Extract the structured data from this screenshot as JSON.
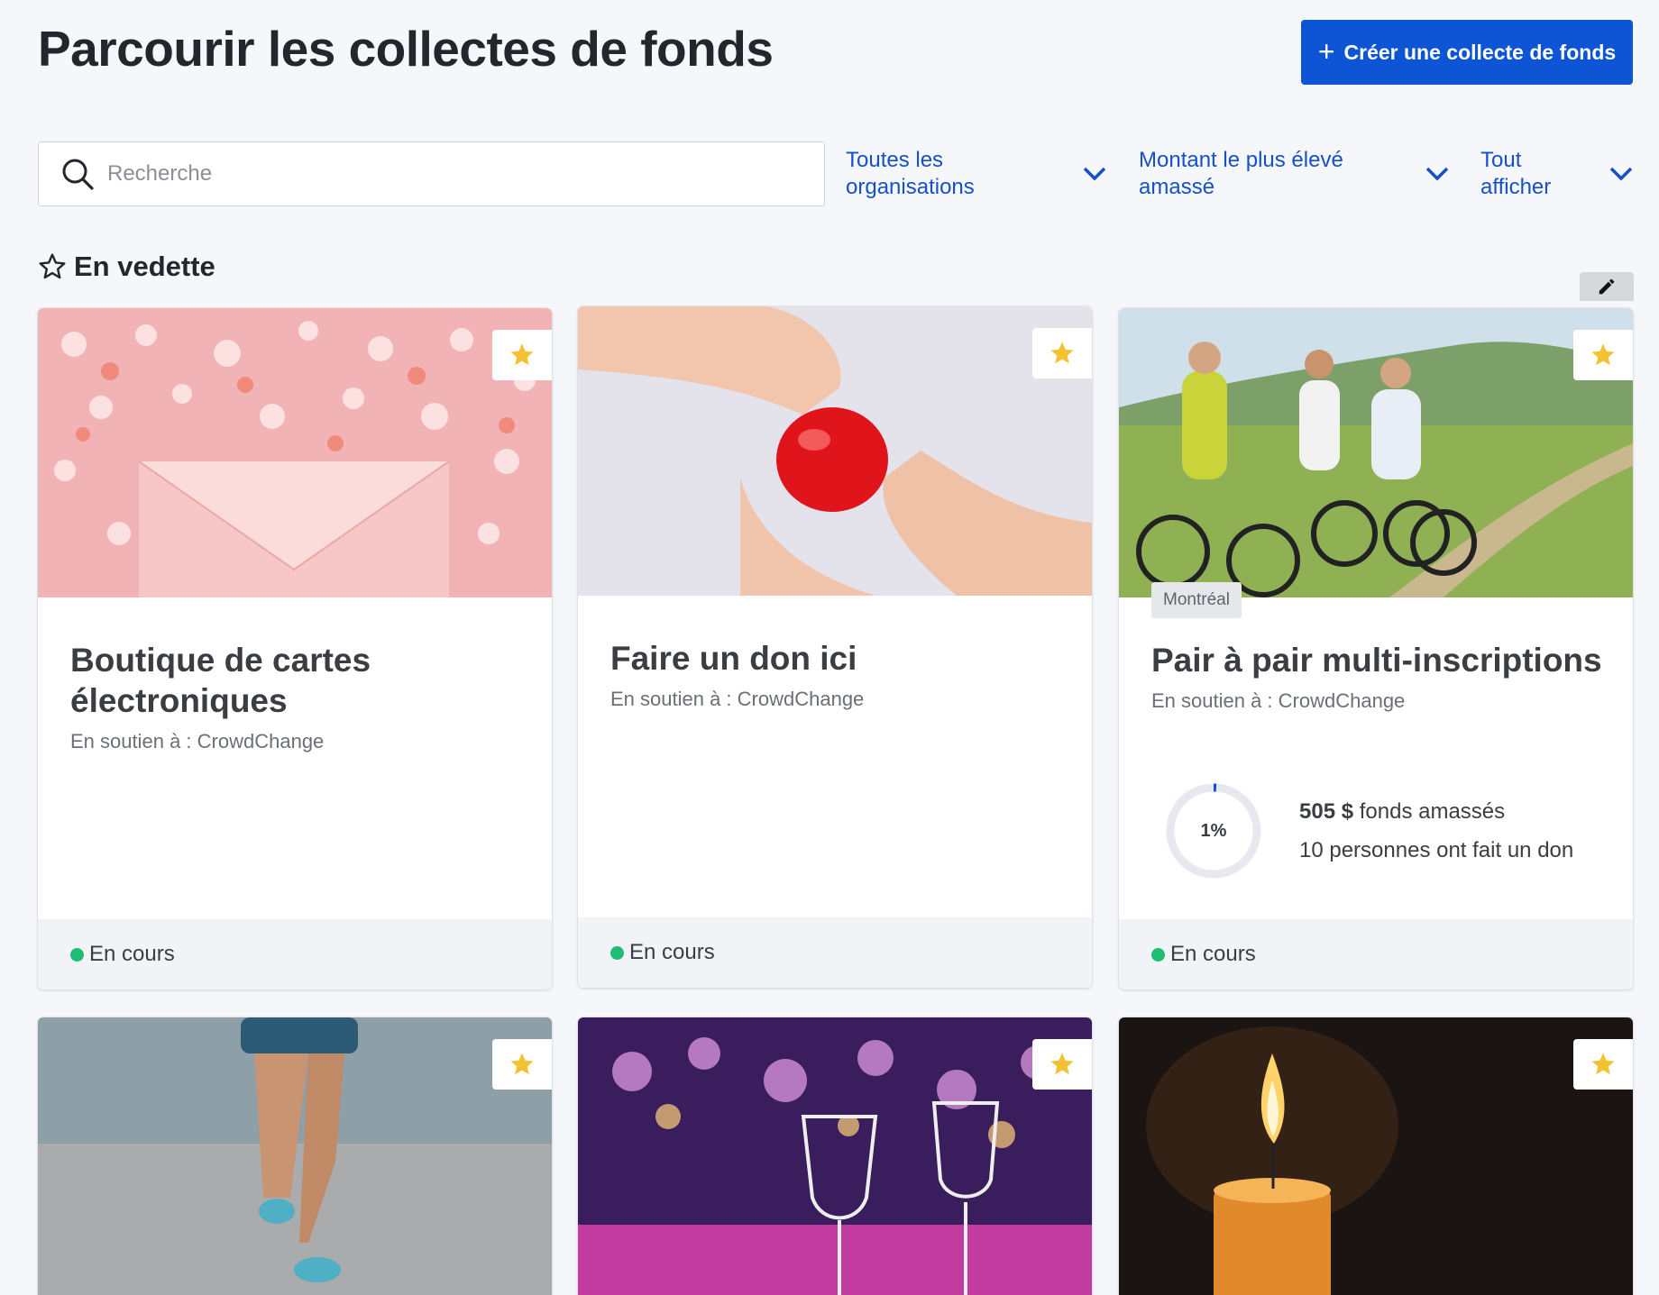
{
  "header": {
    "title": "Parcourir les collectes de fonds",
    "create_label": "Créer une collecte de fonds"
  },
  "filters": {
    "search_placeholder": "Recherche",
    "organisations": "Toutes les organisations",
    "sort": "Montant le plus élevé amassé",
    "show": "Tout afficher"
  },
  "featured": {
    "heading": "En vedette"
  },
  "colors": {
    "primary": "#0e55d6",
    "link": "#1550c8",
    "status_active": "#1dbd73",
    "star": "#f2c233"
  },
  "cards": [
    {
      "title": "Boutique de cartes électroniques",
      "supporting": "En soutien à : CrowdChange",
      "status": "En cours",
      "image": "hearts-envelope"
    },
    {
      "title": "Faire un don ici",
      "supporting": "En soutien à : CrowdChange",
      "status": "En cours",
      "image": "hands-heart"
    },
    {
      "title": "Pair à pair multi-inscriptions",
      "supporting": "En soutien à : CrowdChange",
      "status": "En cours",
      "location": "Montréal",
      "progress_percent": 1,
      "progress_label": "1%",
      "amount": "505 $",
      "amount_suffix": " fonds amassés",
      "donors": "10 personnes ont fait un don",
      "image": "cyclists"
    },
    {
      "image": "runner-legs"
    },
    {
      "image": "wine-glasses"
    },
    {
      "image": "candle"
    }
  ]
}
